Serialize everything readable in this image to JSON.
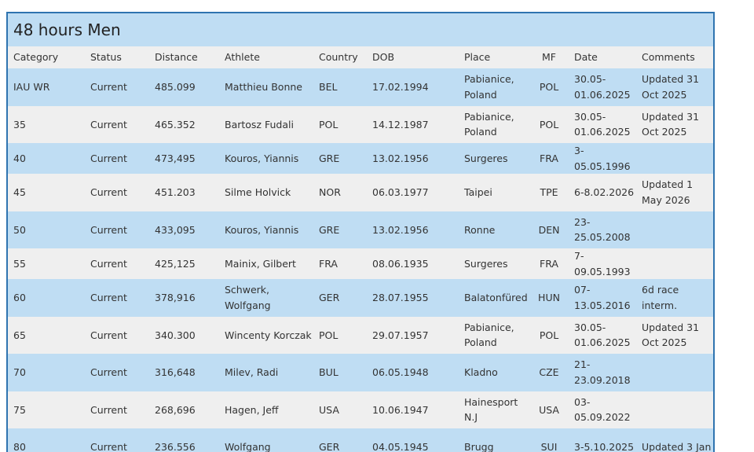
{
  "page": {
    "title": "48 hours Men"
  },
  "table": {
    "headers": [
      "Category",
      "Status",
      "Distance",
      "Athlete",
      "Country",
      "DOB",
      "Place",
      "MF",
      "Date",
      "Comments"
    ],
    "rows": [
      [
        "IAU WR",
        "Current",
        "485.099",
        "Matthieu Bonne",
        "BEL",
        "17.02.1994",
        "Pabianice, Poland",
        "POL",
        "30.05-01.06.2025",
        "Updated 31 Oct 2025"
      ],
      [
        "35",
        "Current",
        "465.352",
        "Bartosz Fudali",
        "POL",
        "14.12.1987",
        "Pabianice, Poland",
        "POL",
        "30.05-01.06.2025",
        "Updated 31 Oct 2025"
      ],
      [
        "40",
        "Current",
        "473,495",
        "Kouros, Yiannis",
        "GRE",
        "13.02.1956",
        "Surgeres",
        "FRA",
        "3-05.05.1996",
        ""
      ],
      [
        "45",
        "Current",
        "451.203",
        "Silme Holvick",
        "NOR",
        "06.03.1977",
        "Taipei",
        "TPE",
        "6-8.02.2026",
        "Updated 1 May 2026"
      ],
      [
        "50",
        "Current",
        "433,095",
        "Kouros, Yiannis",
        "GRE",
        "13.02.1956",
        "Ronne",
        "DEN",
        "23-25.05.2008",
        ""
      ],
      [
        "55",
        "Current",
        "425,125",
        "Mainix, Gilbert",
        "FRA",
        "08.06.1935",
        "Surgeres",
        "FRA",
        "7-09.05.1993",
        ""
      ],
      [
        "60",
        "Current",
        "378,916",
        "Schwerk, Wolfgang",
        "GER",
        "28.07.1955",
        "Balatonfüred",
        "HUN",
        "07-13.05.2016",
        "6d race interm."
      ],
      [
        "65",
        "Current",
        "340.300",
        "Wincenty Korczak",
        "POL",
        "29.07.1957",
        "Pabianice, Poland",
        "POL",
        "30.05-01.06.2025",
        "Updated 31 Oct 2025"
      ],
      [
        "70",
        "Current",
        "316,648",
        "Milev, Radi",
        "BUL",
        "06.05.1948",
        "Kladno",
        "CZE",
        "21-23.09.2018",
        ""
      ],
      [
        "75",
        "Current",
        "268,696",
        "Hagen, Jeff",
        "USA",
        "10.06.1947",
        "Hainesport N.J",
        "USA",
        "03-05.09.2022",
        ""
      ],
      [
        "80",
        "Current",
        "236.556",
        "Wolfgang",
        "GER",
        "04.05.1945",
        "Brugg",
        "SUI",
        "3-5.10.2025",
        "Updated 3 Jan"
      ]
    ]
  }
}
